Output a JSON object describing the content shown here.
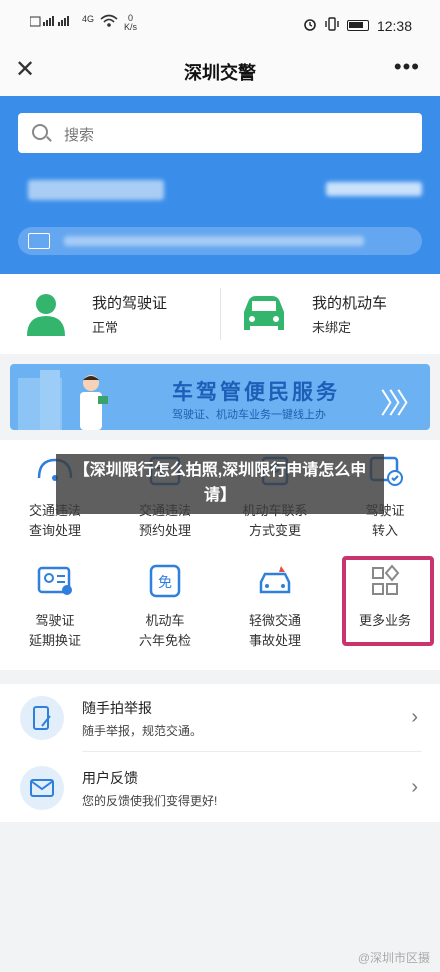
{
  "status_bar": {
    "left_label": "4G",
    "speed_value": "0",
    "speed_unit": "K/s",
    "time": "12:38"
  },
  "title_bar": {
    "title": "深圳交警",
    "more_label": "•••"
  },
  "search": {
    "placeholder": "搜索"
  },
  "license_cards": [
    {
      "title": "我的驾驶证",
      "status": "正常",
      "icon": "person-icon",
      "color": "#34b56e"
    },
    {
      "title": "我的机动车",
      "status": "未绑定",
      "icon": "car-icon",
      "color": "#34b56e"
    }
  ],
  "banner": {
    "title": "车驾管便民服务",
    "subtitle": "驾驶证、机动车业务一键线上办"
  },
  "services": [
    {
      "line1": "交通违法",
      "line2": "查询处理",
      "icon": "violation-search-icon"
    },
    {
      "line1": "交通违法",
      "line2": "预约处理",
      "icon": "violation-appointment-icon"
    },
    {
      "line1": "机动车联系",
      "line2": "方式变更",
      "icon": "contact-change-icon"
    },
    {
      "line1": "驾驶证",
      "line2": "转入",
      "icon": "license-transfer-icon"
    },
    {
      "line1": "驾驶证",
      "line2": "延期换证",
      "icon": "license-renew-icon"
    },
    {
      "line1": "机动车",
      "line2": "六年免检",
      "icon": "inspection-exempt-icon"
    },
    {
      "line1": "轻微交通",
      "line2": "事故处理",
      "icon": "accident-icon"
    },
    {
      "line1": "更多业务",
      "line2": "",
      "icon": "more-services-icon"
    }
  ],
  "overlay": {
    "text": "【深圳限行怎么拍照,深圳限行申请怎么申请】"
  },
  "list_items": [
    {
      "title": "随手拍举报",
      "subtitle": "随手举报，规范交通。",
      "icon": "phone-report-icon"
    },
    {
      "title": "用户反馈",
      "subtitle": "您的反馈使我们变得更好!",
      "icon": "mail-icon"
    }
  ],
  "watermark": "@深圳市区摄",
  "colors": {
    "accent_blue": "#3a8eea",
    "icon_blue": "#2f7fdc",
    "green": "#34b56e",
    "highlight": "#c9346e"
  }
}
